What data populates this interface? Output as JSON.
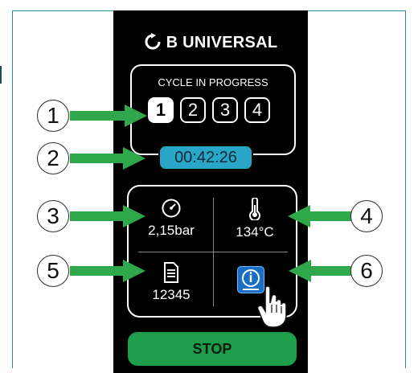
{
  "brand": {
    "name": "B UNIVERSAL",
    "logo_icon": "refresh-icon"
  },
  "cycle": {
    "title": "CYCLE IN PROGRESS",
    "steps": [
      "1",
      "2",
      "3",
      "4"
    ],
    "active_step": "1",
    "timer": "00:42:26"
  },
  "parameters": {
    "pressure": {
      "icon": "gauge-icon",
      "value": "2,15bar"
    },
    "temperature": {
      "icon": "thermometer-icon",
      "value": "134°C"
    },
    "document": {
      "icon": "document-icon",
      "value": "12345"
    },
    "info": {
      "icon": "info-icon"
    }
  },
  "stop_button": {
    "label": "STOP"
  },
  "callouts": [
    "1",
    "2",
    "3",
    "4",
    "5",
    "6"
  ],
  "colors": {
    "screen_bg": "#000000",
    "timer_bg": "#2aa6c8",
    "stop_bg": "#1e9e4a",
    "arrow": "#2ea84a",
    "info_bg": "#1a6fc4",
    "frame": "#2a8aa0"
  }
}
